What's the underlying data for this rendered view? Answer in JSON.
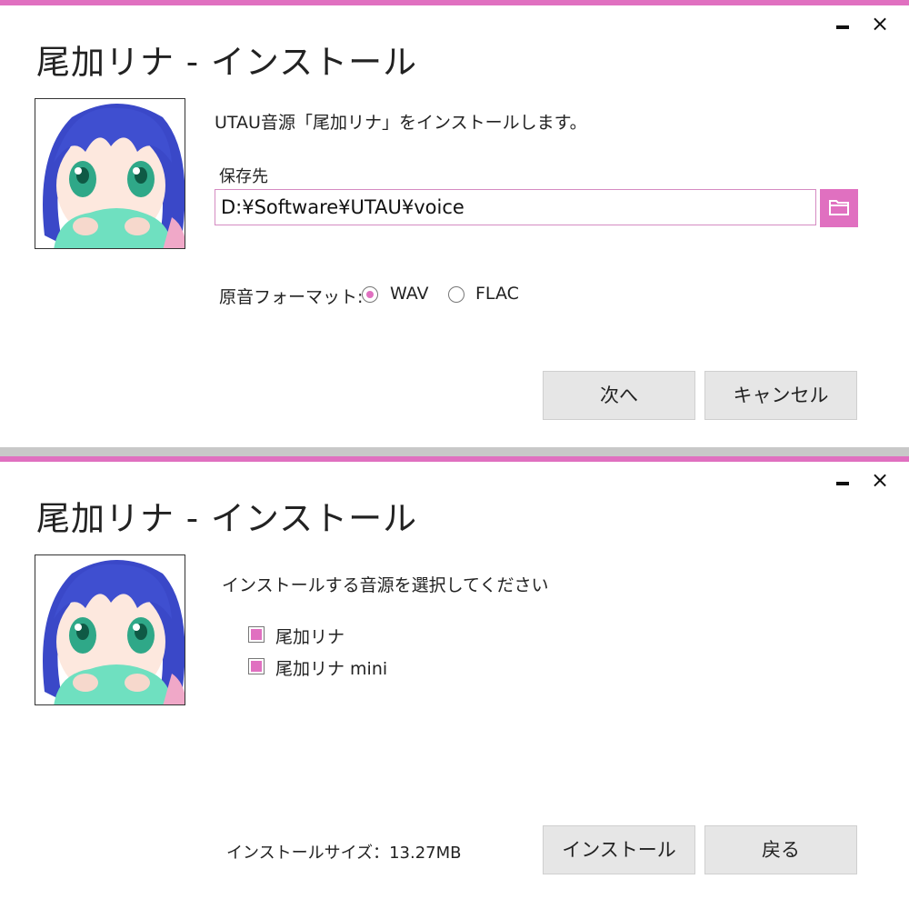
{
  "colors": {
    "accent": "#e070c0",
    "button_bg": "#e6e6e6"
  },
  "icons": {
    "minimize": "minimize-icon",
    "close": "close-icon",
    "folder": "folder-icon"
  },
  "window1": {
    "title": "尾加リナ - インストール",
    "close_glyph": "×",
    "description": "UTAU音源「尾加リナ」をインストールします。",
    "save_location_label": "保存先",
    "save_path": "D:¥Software¥UTAU¥voice",
    "format_label": "原音フォーマット:",
    "format_options": [
      {
        "label": "WAV",
        "selected": true
      },
      {
        "label": "FLAC",
        "selected": false
      }
    ],
    "next_button": "次へ",
    "cancel_button": "キャンセル"
  },
  "window2": {
    "title": "尾加リナ - インストール",
    "close_glyph": "×",
    "instruction": "インストールする音源を選択してください",
    "voicebanks": [
      {
        "label": "尾加リナ",
        "checked": true
      },
      {
        "label": "尾加リナ mini",
        "checked": true
      }
    ],
    "install_size": "インストールサイズ：13.27MB",
    "install_button": "インストール",
    "back_button": "戻る"
  }
}
